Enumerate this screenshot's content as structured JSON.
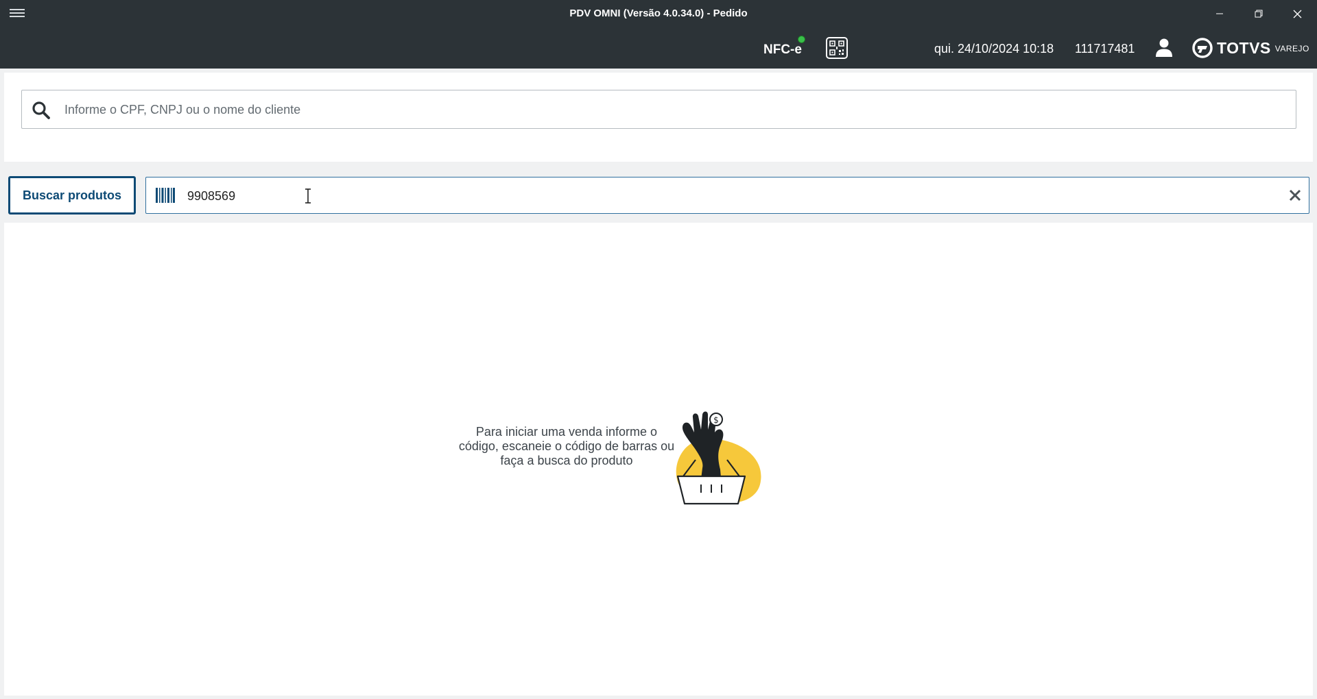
{
  "window": {
    "title": "PDV OMNI (Versão 4.0.34.0) - Pedido"
  },
  "header": {
    "nfce_label": "NFC-e",
    "nfce_status_color": "#39c049",
    "datetime": "qui. 24/10/2024 10:18",
    "operator_id": "111717481",
    "brand_name": "TOTVS",
    "brand_sub": "VAREJO"
  },
  "customer": {
    "search_placeholder": "Informe o CPF, CNPJ ou o nome do cliente",
    "search_value": ""
  },
  "product": {
    "buscar_label": "Buscar produtos",
    "code_value": "9908569"
  },
  "empty_state": {
    "message": "Para iniciar uma venda informe o código, escaneie o código de barras ou faça a busca do produto"
  },
  "colors": {
    "topbar": "#2c3337",
    "accent": "#0d4a75",
    "illustration_yellow": "#f6c83b"
  },
  "icons": [
    "hamburger-menu-icon",
    "minimize-icon",
    "restore-icon",
    "close-icon",
    "qr-code-icon",
    "user-icon",
    "totvs-logo-icon",
    "search-icon",
    "barcode-icon",
    "clear-icon",
    "text-cursor-icon",
    "hand-basket-illustration"
  ]
}
